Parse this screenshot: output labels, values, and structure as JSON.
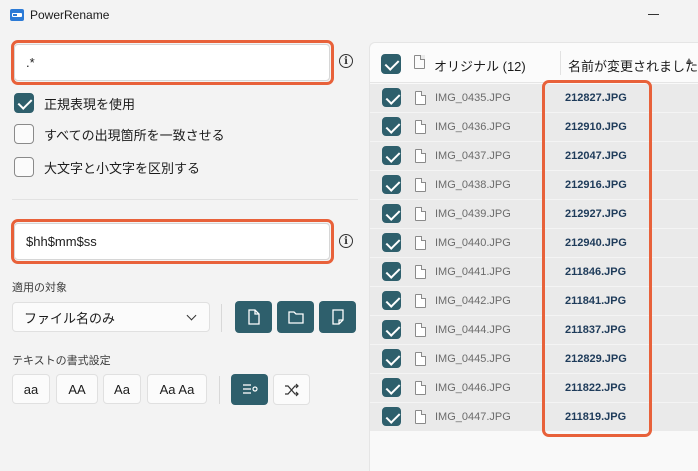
{
  "window": {
    "title": "PowerRename"
  },
  "search": {
    "value": ".*"
  },
  "options": [
    {
      "label": "正規表現を使用",
      "checked": true
    },
    {
      "label": "すべての出現箇所を一致させる",
      "checked": false
    },
    {
      "label": "大文字と小文字を区別する",
      "checked": false
    }
  ],
  "replace": {
    "value": "$hh$mm$ss"
  },
  "apply_to": {
    "label": "適用の対象",
    "selected": "ファイル名のみ"
  },
  "text_format": {
    "label": "テキストの書式設定",
    "cases": [
      "aa",
      "AA",
      "Aa",
      "Aa Aa"
    ]
  },
  "list": {
    "original_header": "オリジナル (12)",
    "renamed_header": "名前が変更されました",
    "rows": [
      {
        "original": "IMG_0435.JPG",
        "renamed": "212827.JPG"
      },
      {
        "original": "IMG_0436.JPG",
        "renamed": "212910.JPG"
      },
      {
        "original": "IMG_0437.JPG",
        "renamed": "212047.JPG"
      },
      {
        "original": "IMG_0438.JPG",
        "renamed": "212916.JPG"
      },
      {
        "original": "IMG_0439.JPG",
        "renamed": "212927.JPG"
      },
      {
        "original": "IMG_0440.JPG",
        "renamed": "212940.JPG"
      },
      {
        "original": "IMG_0441.JPG",
        "renamed": "211846.JPG"
      },
      {
        "original": "IMG_0442.JPG",
        "renamed": "211841.JPG"
      },
      {
        "original": "IMG_0444.JPG",
        "renamed": "211837.JPG"
      },
      {
        "original": "IMG_0445.JPG",
        "renamed": "212829.JPG"
      },
      {
        "original": "IMG_0446.JPG",
        "renamed": "211822.JPG"
      },
      {
        "original": "IMG_0447.JPG",
        "renamed": "211819.JPG"
      }
    ]
  },
  "colors": {
    "accent": "#2e5f6c",
    "highlight": "#e8613a"
  }
}
